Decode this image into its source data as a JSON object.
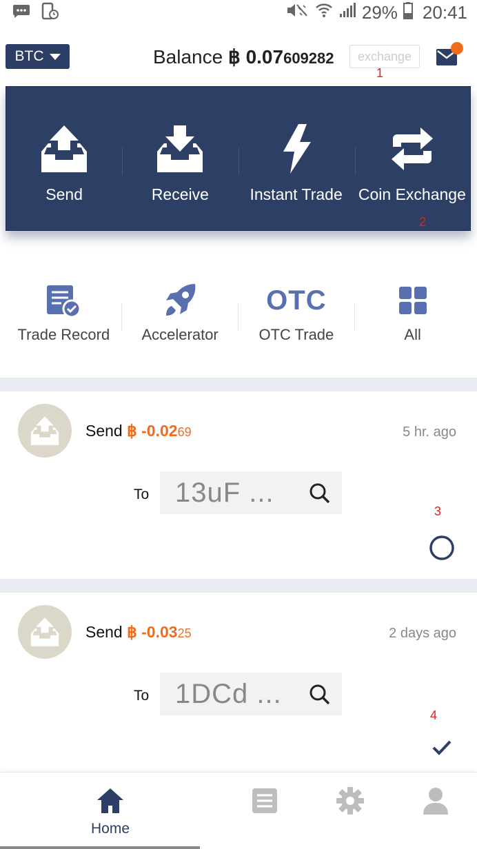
{
  "status_bar": {
    "battery": "29%",
    "time": "20:41",
    "icons": [
      "message-icon",
      "phone-clock-icon",
      "mute-icon",
      "wifi-icon",
      "signal-icon",
      "battery-icon"
    ]
  },
  "header": {
    "coin": "BTC",
    "balance_label": "Balance",
    "btc_symbol": "฿",
    "balance_main": "0.07",
    "balance_rest": "609282",
    "exchange_label": "exchange"
  },
  "annotations": [
    "1",
    "2",
    "3",
    "4"
  ],
  "actions": [
    {
      "label": "Send",
      "icon": "send-tray-icon"
    },
    {
      "label": "Receive",
      "icon": "receive-tray-icon"
    },
    {
      "label": "Instant Trade",
      "icon": "lightning-icon"
    },
    {
      "label": "Coin Exchange",
      "icon": "exchange-arrows-icon"
    }
  ],
  "shortcuts": [
    {
      "label": "Trade Record",
      "icon": "trade-record-icon"
    },
    {
      "label": "Accelerator",
      "icon": "rocket-icon"
    },
    {
      "label": "OTC Trade",
      "icon_text": "OTC"
    },
    {
      "label": "All",
      "icon": "grid-icon"
    }
  ],
  "transactions": [
    {
      "type": "Send",
      "symbol": "฿",
      "amount_main": "-0.02",
      "amount_rest": "69",
      "time": "5 hr. ago",
      "to_label": "To",
      "address": "13uF ...",
      "status": "pending"
    },
    {
      "type": "Send",
      "symbol": "฿",
      "amount_main": "-0.03",
      "amount_rest": "25",
      "time": "2 days ago",
      "to_label": "To",
      "address": "1DCd ...",
      "status": "confirmed"
    }
  ],
  "bottom_nav": [
    {
      "label": "Home",
      "icon": "home-icon",
      "active": true
    },
    {
      "label": "",
      "icon": "list-icon",
      "active": false
    },
    {
      "label": "",
      "icon": "gear-icon",
      "active": false
    },
    {
      "label": "",
      "icon": "user-icon",
      "active": false
    }
  ],
  "colors": {
    "primary": "#2e3f66",
    "accent": "#f26b1d",
    "icon_blue": "#5870b0",
    "list_bg": "#e9ecf2"
  }
}
